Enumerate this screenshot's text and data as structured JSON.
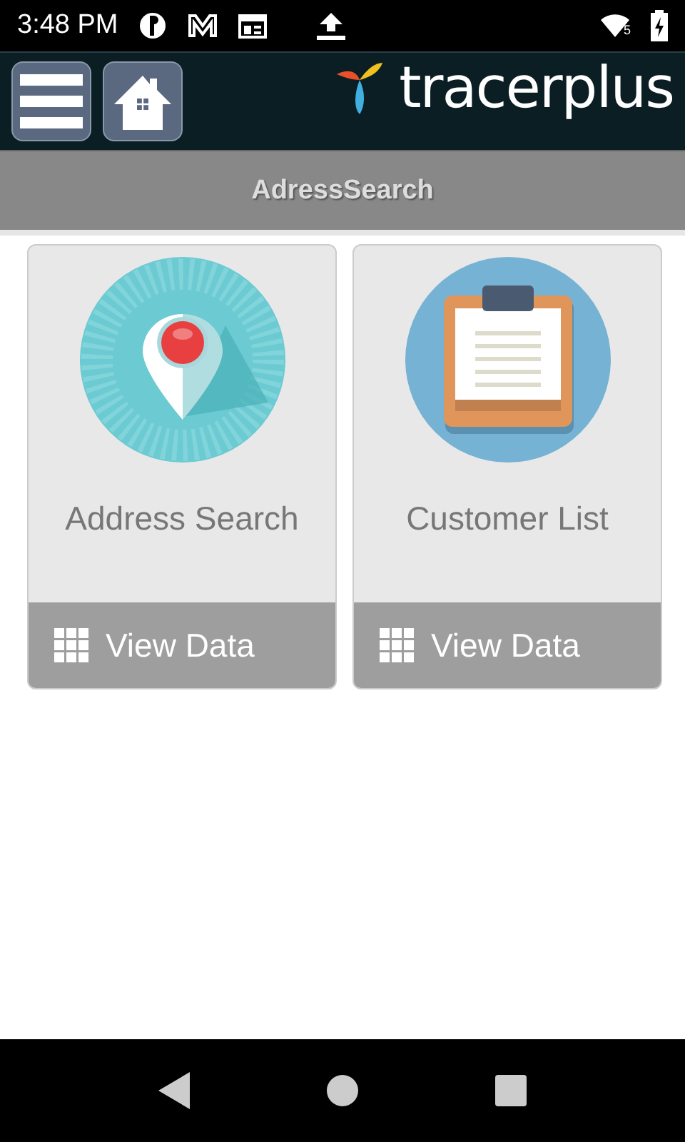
{
  "status_bar": {
    "time": "3:48 PM",
    "wifi_band": "5"
  },
  "app_bar": {
    "logo_text": "tracerplus"
  },
  "title_bar": {
    "title": "AdressSearch"
  },
  "cards": [
    {
      "kind": "pin",
      "label": "Address Search",
      "action": "View Data"
    },
    {
      "kind": "clipboard",
      "label": "Customer List",
      "action": "View Data"
    }
  ]
}
